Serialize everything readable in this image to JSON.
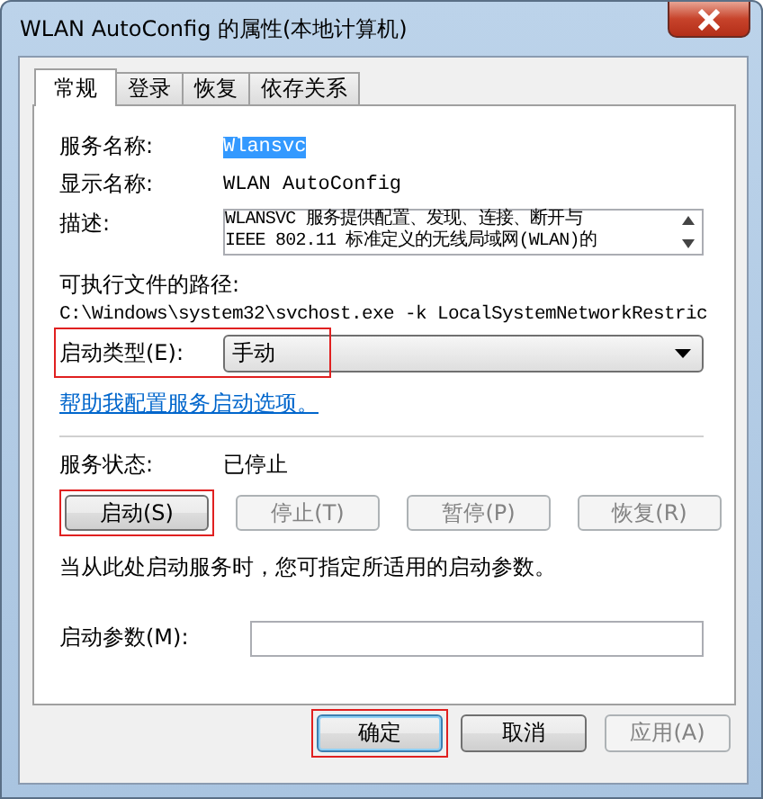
{
  "window": {
    "title": "WLAN AutoConfig 的属性(本地计算机)"
  },
  "tabs": [
    {
      "label": "常规",
      "selected": true
    },
    {
      "label": "登录",
      "selected": false
    },
    {
      "label": "恢复",
      "selected": false
    },
    {
      "label": "依存关系",
      "selected": false
    }
  ],
  "service_name": {
    "label": "服务名称:",
    "value": "Wlansvc",
    "selected": true
  },
  "display_name": {
    "label": "显示名称:",
    "value": "WLAN AutoConfig"
  },
  "description": {
    "label": "描述:",
    "lines": [
      "WLANSVC 服务提供配置、发现、连接、断开与",
      "IEEE 802.11 标准定义的无线局域网(WLAN)的"
    ]
  },
  "executable_path": {
    "label": "可执行文件的路径:",
    "value": "C:\\Windows\\system32\\svchost.exe -k LocalSystemNetworkRestric"
  },
  "startup_type": {
    "label": "启动类型(E):",
    "value": "手动",
    "highlighted": true
  },
  "help_link": "帮助我配置服务启动选项。",
  "service_status": {
    "label": "服务状态:",
    "value": "已停止"
  },
  "service_buttons": [
    {
      "label": "启动(S)",
      "disabled": false,
      "highlighted": true
    },
    {
      "label": "停止(T)",
      "disabled": true,
      "highlighted": false
    },
    {
      "label": "暂停(P)",
      "disabled": true,
      "highlighted": false
    },
    {
      "label": "恢复(R)",
      "disabled": true,
      "highlighted": false
    }
  ],
  "hint": "当从此处启动服务时，您可指定所适用的启动参数。",
  "start_parameters": {
    "label": "启动参数(M):"
  },
  "dialog_buttons": [
    {
      "label": "确定",
      "disabled": false,
      "highlighted": true
    },
    {
      "label": "取消",
      "disabled": false,
      "highlighted": false
    },
    {
      "label": "应用(A)",
      "disabled": true,
      "highlighted": false
    }
  ]
}
